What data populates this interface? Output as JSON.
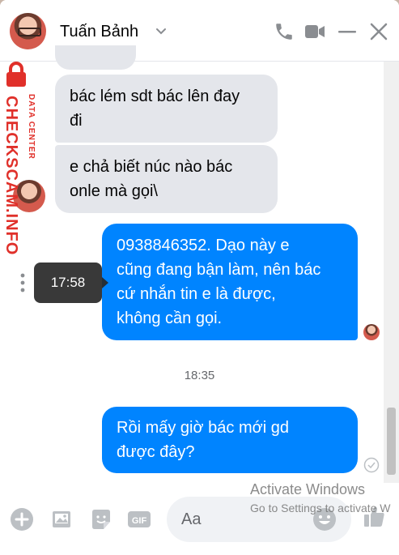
{
  "header": {
    "contact_name": "Tuấn Bảnh",
    "icons": [
      "chevron-down-icon",
      "phone-icon",
      "video-icon",
      "minimize-icon",
      "close-icon"
    ]
  },
  "watermark": {
    "small_text": "DATA CENTER",
    "big_text": "CHECKSCAM.INFO",
    "color": "#e0302a"
  },
  "messages": [
    {
      "direction": "incoming",
      "lines": [
        "bác lém sdt bác lên đay",
        "đi"
      ]
    },
    {
      "direction": "incoming",
      "lines": [
        "e chả biết núc nào bác",
        "onle mà gọi\\"
      ]
    },
    {
      "direction": "outgoing",
      "lines": [
        "0938846352. Dạo này e",
        "cũng đang bận làm, nên bác",
        "cứ nhắn tin e là được,",
        "không cần gọi."
      ]
    },
    {
      "direction": "outgoing",
      "lines": [
        "Rồi mấy giờ bác mới gd",
        "được đây?"
      ]
    }
  ],
  "tooltip_time": "17:58",
  "timestamp": "18:35",
  "composer": {
    "placeholder": "Aa",
    "icons": [
      "add-icon",
      "photo-icon",
      "sticker-icon",
      "gif-icon",
      "emoji-icon",
      "like-icon"
    ]
  },
  "system_overlay": {
    "title": "Activate Windows",
    "subtitle": "Go to Settings to activate W"
  },
  "colors": {
    "accent": "#0084ff",
    "incoming_bubble": "#e4e6eb"
  }
}
